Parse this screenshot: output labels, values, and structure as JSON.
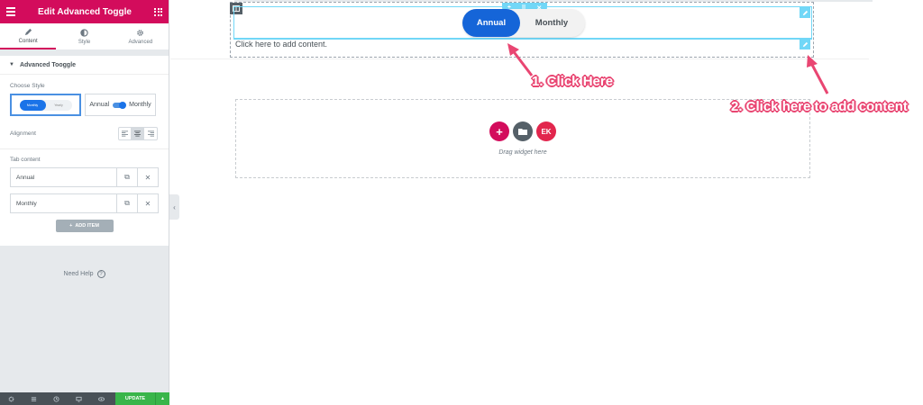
{
  "panel": {
    "title": "Edit Advanced Toggle",
    "tabs": [
      {
        "label": "Content",
        "icon": "pencil-icon"
      },
      {
        "label": "Style",
        "icon": "half-circle-icon"
      },
      {
        "label": "Advanced",
        "icon": "gear-icon"
      }
    ],
    "section_title": "Advanced Tooggle",
    "choose_style_label": "Choose Style",
    "style1": {
      "on": "Monthly",
      "off": "Yearly"
    },
    "style2": {
      "left": "Annual",
      "right": "Monthly"
    },
    "alignment_label": "Alignment",
    "tab_content_label": "Tab content",
    "items": [
      "Annual",
      "Monthly"
    ],
    "add_item": "ADD ITEM",
    "need_help": "Need Help",
    "update": "UPDATE",
    "accent_color": "#d30c5c"
  },
  "canvas": {
    "toggle": {
      "active": "Annual",
      "inactive": "Monthly",
      "active_color": "#1565d8"
    },
    "add_content": "Click here to add content.",
    "drag_widget": "Drag widget here"
  },
  "annotations": {
    "step1": "1. Click Here",
    "step2": "2. Click here to add content",
    "color": "#e94672"
  }
}
